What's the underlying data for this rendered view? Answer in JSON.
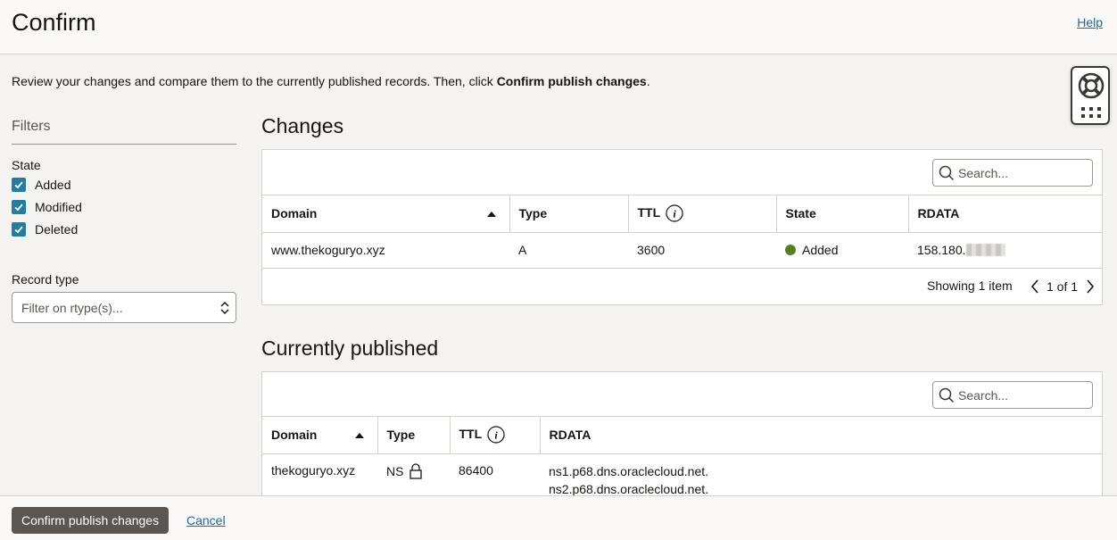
{
  "header": {
    "title": "Confirm",
    "help_label": "Help"
  },
  "intro": {
    "text_before": "Review your changes and compare them to the currently published records. Then, click ",
    "bold": "Confirm publish changes",
    "text_after": "."
  },
  "filters": {
    "title": "Filters",
    "state_label": "State",
    "states": [
      {
        "label": "Added",
        "checked": true
      },
      {
        "label": "Modified",
        "checked": true
      },
      {
        "label": "Deleted",
        "checked": true
      }
    ],
    "record_type_label": "Record type",
    "record_type_placeholder": "Filter on rtype(s)..."
  },
  "changes": {
    "title": "Changes",
    "search_placeholder": "Search...",
    "columns": {
      "domain": "Domain",
      "type": "Type",
      "ttl": "TTL",
      "state": "State",
      "rdata": "RDATA"
    },
    "rows": [
      {
        "domain": "www.thekoguryo.xyz",
        "type": "A",
        "ttl": "3600",
        "state": "Added",
        "rdata": "158.180."
      }
    ],
    "pager": {
      "showing": "Showing 1 item",
      "position": "1 of 1"
    },
    "state_color": "#508223"
  },
  "published": {
    "title": "Currently published",
    "search_placeholder": "Search...",
    "columns": {
      "domain": "Domain",
      "type": "Type",
      "ttl": "TTL",
      "rdata": "RDATA"
    },
    "rows": [
      {
        "domain": "thekoguryo.xyz",
        "type": "NS",
        "ttl": "86400",
        "rdata": [
          "ns1.p68.dns.oraclecloud.net.",
          "ns2.p68.dns.oraclecloud.net."
        ]
      }
    ]
  },
  "footer": {
    "confirm_label": "Confirm publish changes",
    "cancel_label": "Cancel"
  },
  "colors": {
    "accent": "#227e9e",
    "link": "#1a6aa8",
    "primary_button": "#5b5652"
  }
}
